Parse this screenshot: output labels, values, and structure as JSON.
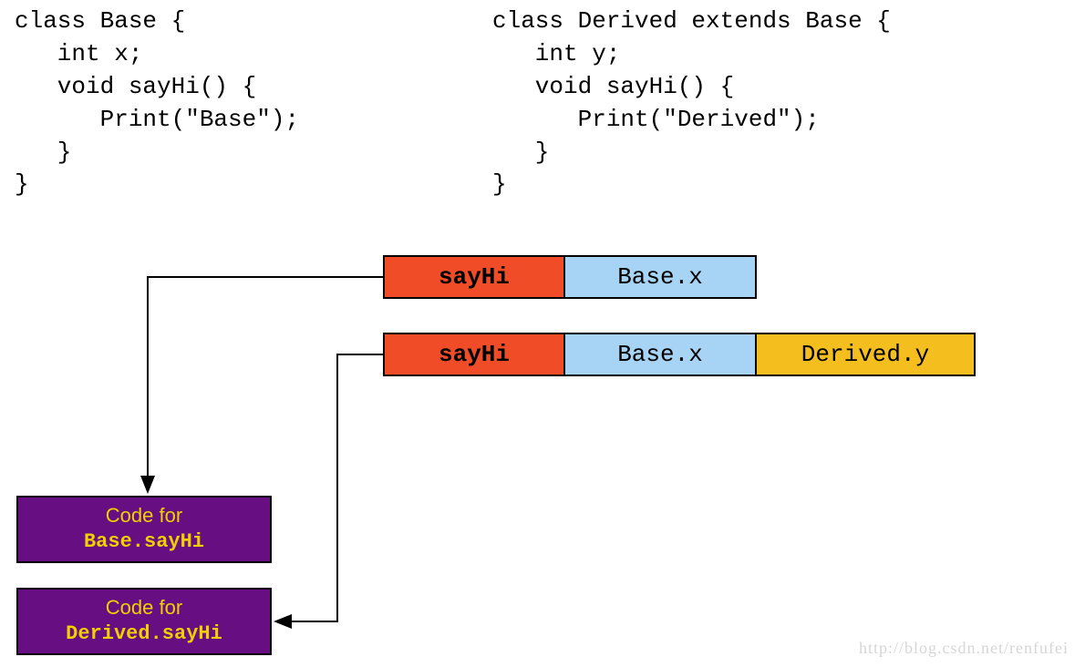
{
  "code_left": "class Base {\n   int x;\n   void sayHi() {\n      Print(\"Base\");\n   }\n}",
  "code_right": "class Derived extends Base {\n   int y;\n   void sayHi() {\n      Print(\"Derived\");\n   }\n}",
  "row1": {
    "sayhi": "sayHi",
    "basex": "Base.x"
  },
  "row2": {
    "sayhi": "sayHi",
    "basex": "Base.x",
    "derivedy": "Derived.y"
  },
  "box1": {
    "line1": "Code for",
    "line2": "Base.sayHi"
  },
  "box2": {
    "line1": "Code for",
    "line2": "Derived.sayHi"
  },
  "watermark": "http://blog.csdn.net/renfufei"
}
